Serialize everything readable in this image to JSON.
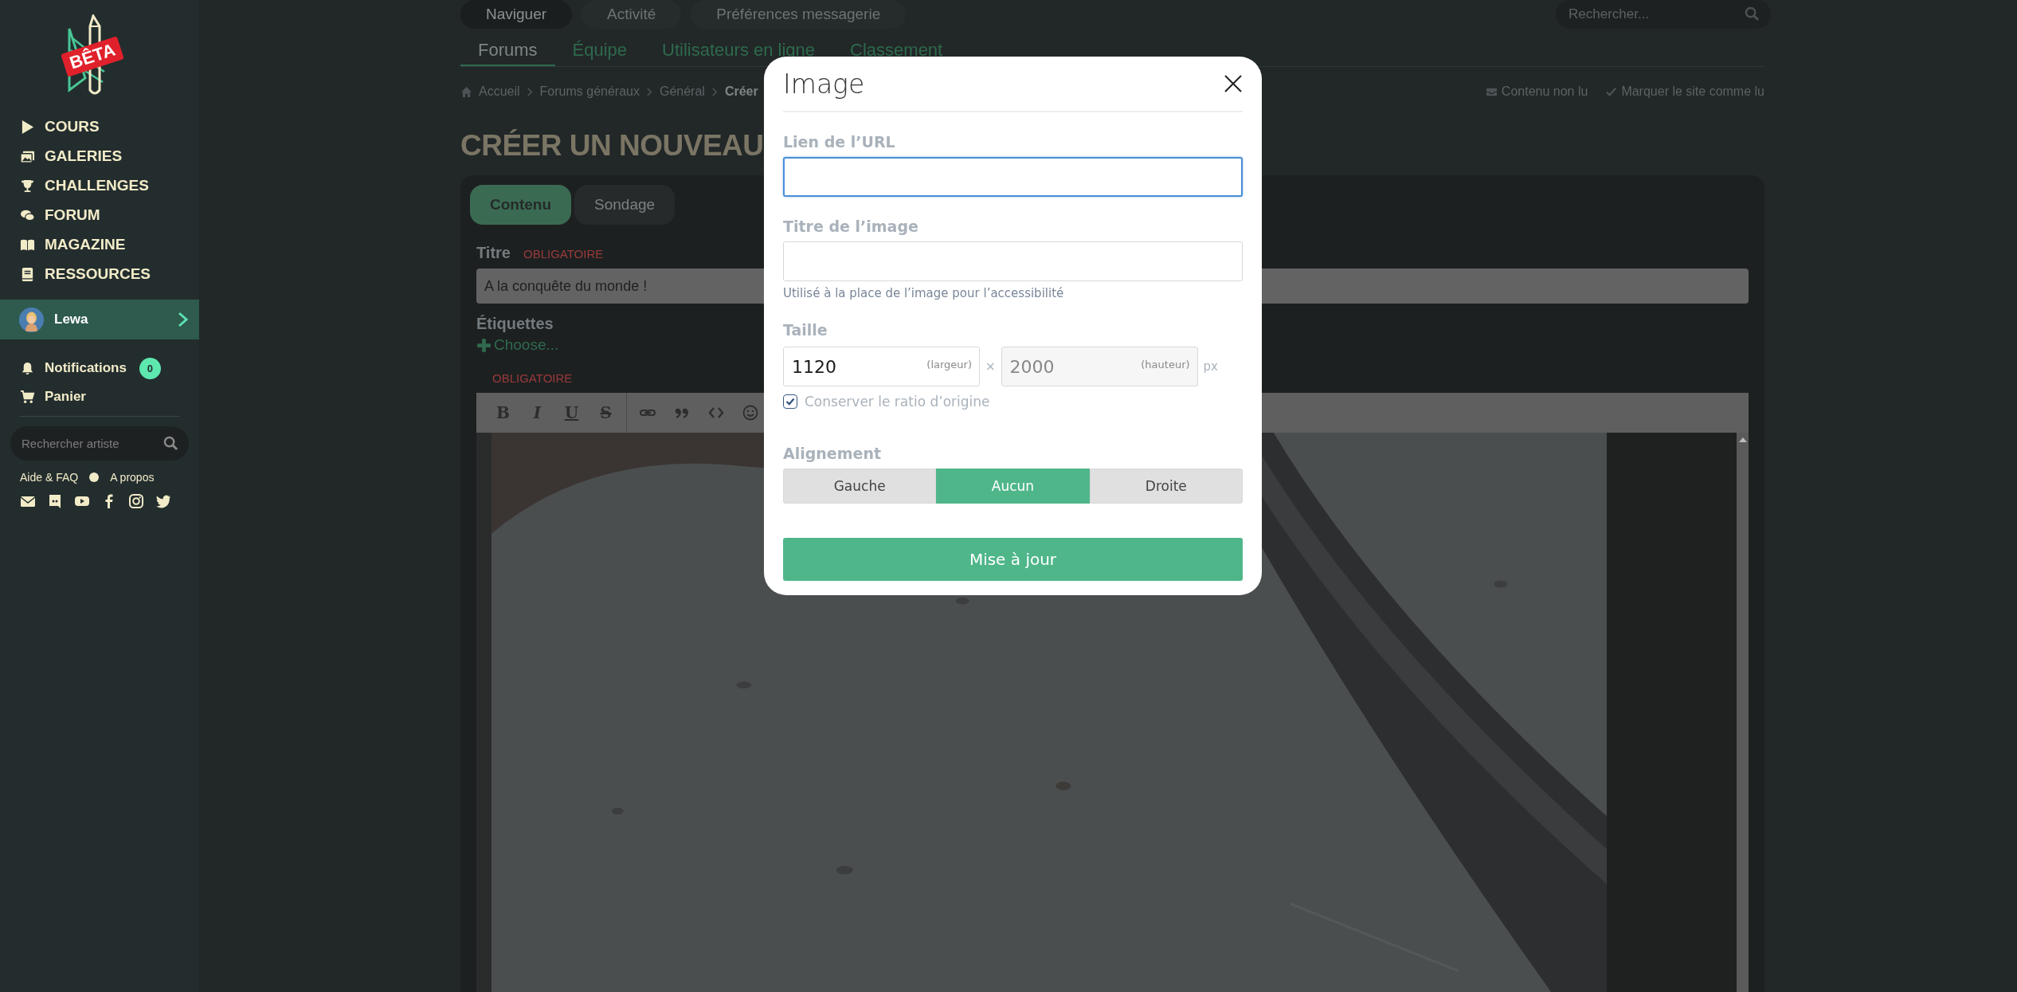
{
  "sidebar": {
    "logo_badge": "BÊTA",
    "nav": [
      {
        "label": "COURS",
        "kind": "play"
      },
      {
        "label": "GALERIES",
        "kind": "gallery"
      },
      {
        "label": "CHALLENGES",
        "kind": "trophy"
      },
      {
        "label": "FORUM",
        "kind": "chat"
      },
      {
        "label": "MAGAZINE",
        "kind": "book"
      },
      {
        "label": "RESSOURCES",
        "kind": "notebook"
      }
    ],
    "user": {
      "name": "Lewa"
    },
    "links": [
      {
        "label": "Notifications",
        "kind": "bell",
        "badge": "0"
      },
      {
        "label": "Panier",
        "kind": "cart"
      }
    ],
    "search": {
      "placeholder": "Rechercher artiste"
    },
    "footer_links": [
      "Aide & FAQ",
      "A propos"
    ]
  },
  "top_tabs": [
    {
      "label": "Naviguer",
      "selected": true
    },
    {
      "label": "Activité",
      "selected": false
    },
    {
      "label": "Préférences messagerie",
      "selected": false
    }
  ],
  "top_search": {
    "placeholder": "Rechercher..."
  },
  "sub_tabs": [
    {
      "label": "Forums",
      "selected": true
    },
    {
      "label": "Équipe",
      "selected": false
    },
    {
      "label": "Utilisateurs en ligne",
      "selected": false
    },
    {
      "label": "Classement",
      "selected": false
    }
  ],
  "breadcrumb": [
    "Accueil",
    "Forums généraux",
    "Général",
    "Créer"
  ],
  "page_actions": [
    {
      "label": "Contenu non lu",
      "kind": "inbox"
    },
    {
      "label": "Marquer le site comme lu",
      "kind": "check"
    }
  ],
  "heading": "CRÉER UN NOUVEAU",
  "editor": {
    "tabs": [
      {
        "label": "Contenu",
        "selected": true
      },
      {
        "label": "Sondage",
        "selected": false
      }
    ],
    "title_label": "Titre",
    "title_required": "OBLIGATOIRE",
    "title_value": "A la conquête du monde !",
    "tags_label": "Étiquettes",
    "tags_action": "Choose...",
    "body_required": "OBLIGATOIRE",
    "toolbar": [
      {
        "kind": "bold",
        "label": "B"
      },
      {
        "kind": "italic",
        "label": "I"
      },
      {
        "kind": "underline",
        "label": "U"
      },
      {
        "kind": "strike",
        "label": "S"
      },
      {
        "kind": "link"
      },
      {
        "kind": "quote"
      },
      {
        "kind": "code"
      },
      {
        "kind": "emoji"
      }
    ]
  },
  "modal": {
    "title": "Image",
    "url": {
      "label": "Lien de l’URL",
      "focused": true
    },
    "alt": {
      "label": "Titre de l’image",
      "hint": "Utilisé à la place de l’image pour l’accessibilité"
    },
    "size_label": "Taille",
    "width": {
      "value": "1120",
      "hint": "(largeur)",
      "disabled": false
    },
    "times": "×",
    "height": {
      "value": "2000",
      "hint": "(hauteur)",
      "disabled": true
    },
    "unit": "px",
    "keep_ratio": {
      "label": "Conserver le ratio d’origine",
      "checked": true
    },
    "align_label": "Alignement",
    "align_options": [
      {
        "label": "Gauche",
        "selected": false
      },
      {
        "label": "Aucun",
        "selected": true
      },
      {
        "label": "Droite",
        "selected": false
      }
    ],
    "submit": "Mise à jour"
  }
}
